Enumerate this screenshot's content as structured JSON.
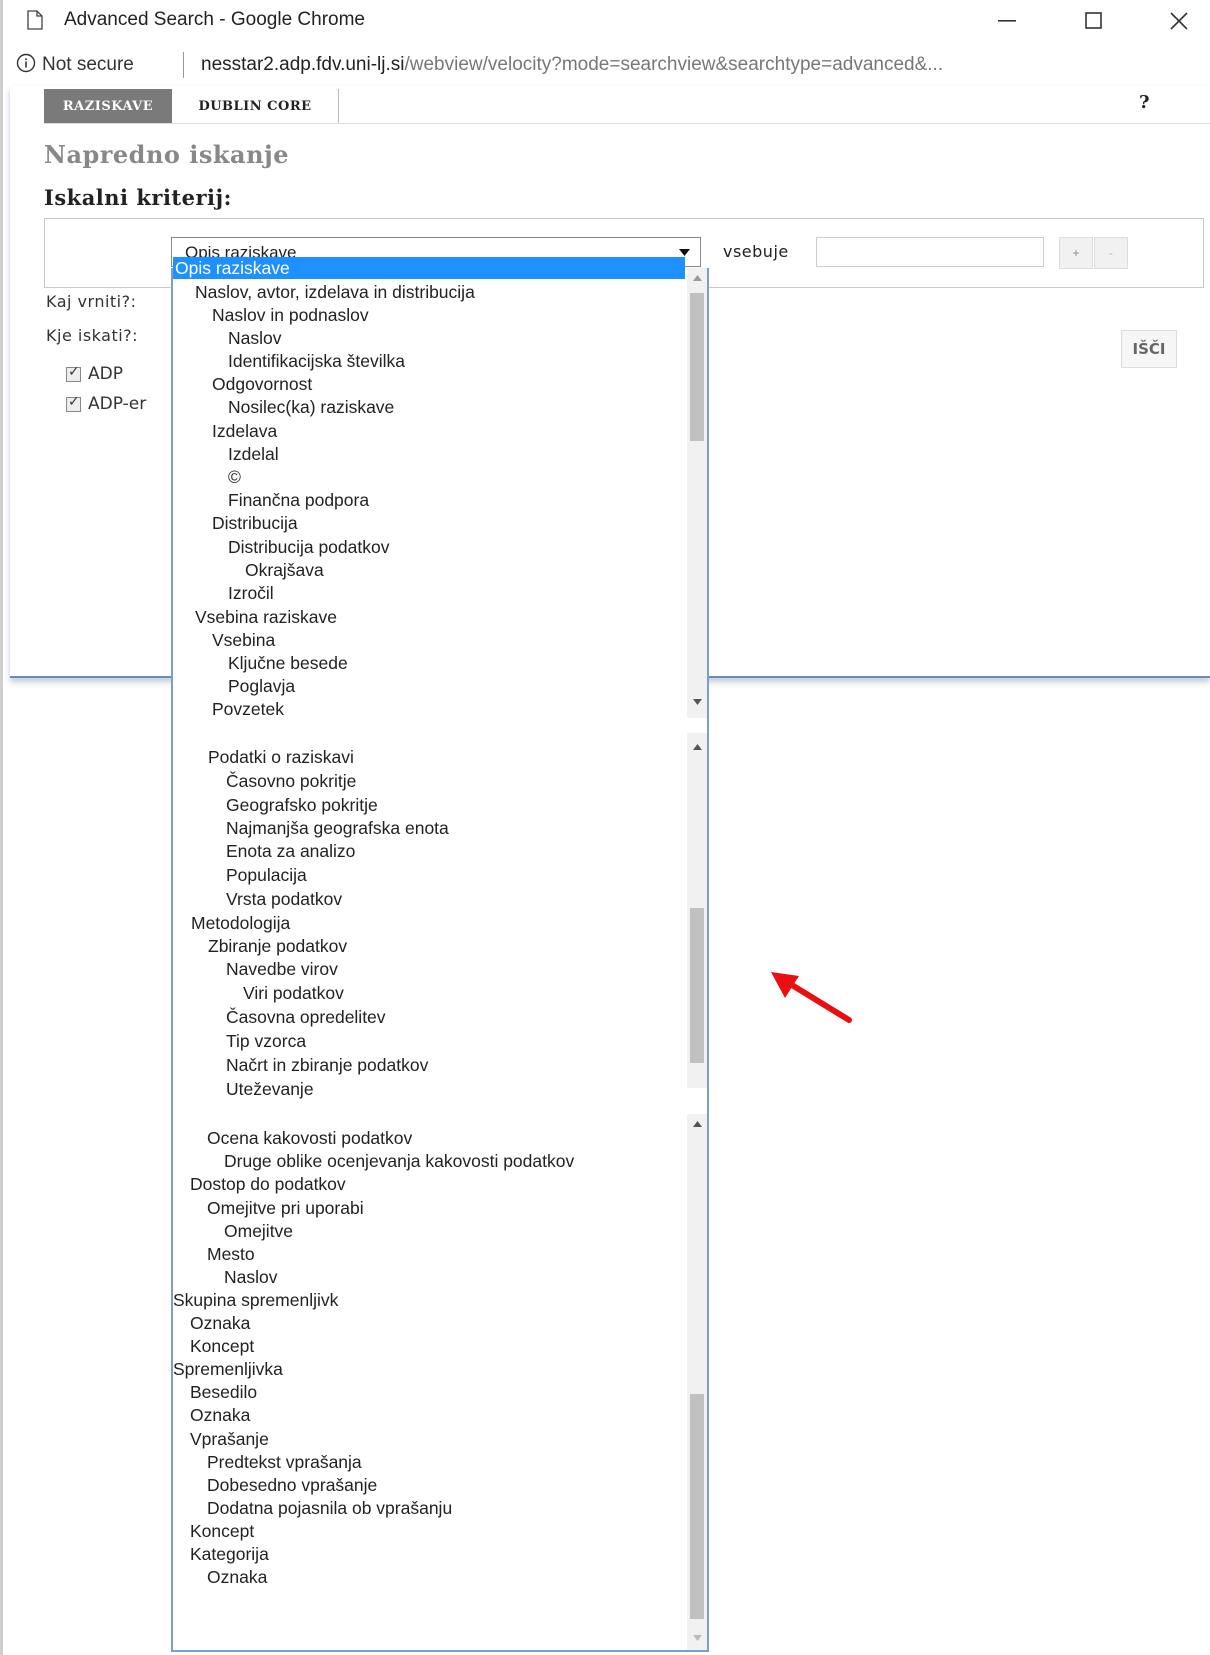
{
  "window": {
    "title": "Advanced Search - Google Chrome",
    "minimize_icon": "minimize-icon",
    "maximize_icon": "maximize-icon",
    "close_icon": "close-icon"
  },
  "address_bar": {
    "security": "Not secure",
    "url_host": "nesstar2.adp.fdv.uni-lj.si",
    "url_path": "/webview/velocity?mode=searchview&searchtype=advanced&..."
  },
  "tabs": [
    {
      "label": "RAZISKAVE",
      "active": true
    },
    {
      "label": "DUBLIN CORE",
      "active": false
    }
  ],
  "help_label": "?",
  "page_title": "Napredno iskanje",
  "criteria_heading": "Iskalni kriterij:",
  "criteria": {
    "selected_field": "Opis raziskave",
    "operator": "vsebuje",
    "input_value": "",
    "add_label": "+",
    "remove_label": "-"
  },
  "labels": {
    "what_to_return": "Kaj vrniti?:",
    "where_to_search": "Kje iskati?:"
  },
  "sources": [
    {
      "label": "ADP",
      "checked": true
    },
    {
      "label": "ADP-er",
      "checked": true
    }
  ],
  "search_button": "IŠČI",
  "dropdown_options": [
    {
      "label": "Opis raziskave",
      "selected": true
    },
    {
      "label": "Naslov, avtor, izdelava in distribucija"
    },
    {
      "label": "Naslov in podnaslov"
    },
    {
      "label": "Naslov"
    },
    {
      "label": "Identifikacijska številka"
    },
    {
      "label": "Odgovornost"
    },
    {
      "label": "Nosilec(ka) raziskave"
    },
    {
      "label": "Izdelava"
    },
    {
      "label": "Izdelal"
    },
    {
      "label": "©"
    },
    {
      "label": "Finančna podpora"
    },
    {
      "label": "Distribucija"
    },
    {
      "label": "Distribucija podatkov"
    },
    {
      "label": "Okrajšava"
    },
    {
      "label": "Izročil"
    },
    {
      "label": "Vsebina raziskave"
    },
    {
      "label": "Vsebina"
    },
    {
      "label": "Ključne besede"
    },
    {
      "label": "Poglavja"
    },
    {
      "label": "Povzetek"
    },
    {
      "label": "Podatki o raziskavi"
    },
    {
      "label": "Časovno pokritje"
    },
    {
      "label": "Geografsko pokritje"
    },
    {
      "label": "Najmanjša geografska enota"
    },
    {
      "label": "Enota za analizo"
    },
    {
      "label": "Populacija"
    },
    {
      "label": "Vrsta podatkov"
    },
    {
      "label": "Metodologija"
    },
    {
      "label": "Zbiranje podatkov"
    },
    {
      "label": "Navedbe virov"
    },
    {
      "label": "Viri podatkov"
    },
    {
      "label": "Časovna opredelitev"
    },
    {
      "label": "Tip vzorca"
    },
    {
      "label": "Načrt in zbiranje podatkov"
    },
    {
      "label": "Uteževanje"
    },
    {
      "label": "Ocena kakovosti podatkov"
    },
    {
      "label": "Druge oblike ocenjevanja kakovosti podatkov"
    },
    {
      "label": "Dostop do podatkov"
    },
    {
      "label": "Omejitve pri uporabi"
    },
    {
      "label": "Omejitve"
    },
    {
      "label": "Mesto"
    },
    {
      "label": "Naslov"
    },
    {
      "label": "Skupina spremenljivk"
    },
    {
      "label": "Oznaka"
    },
    {
      "label": "Koncept"
    },
    {
      "label": "Spremenljivka"
    },
    {
      "label": "Besedilo"
    },
    {
      "label": "Oznaka"
    },
    {
      "label": "Vprašanje"
    },
    {
      "label": "Predtekst vprašanja"
    },
    {
      "label": "Dobesedno vprašanje"
    },
    {
      "label": "Dodatna pojasnila ob vprašanju"
    },
    {
      "label": "Koncept"
    },
    {
      "label": "Kategorija"
    },
    {
      "label": "Oznaka"
    }
  ],
  "annotation_color": "#e81010"
}
